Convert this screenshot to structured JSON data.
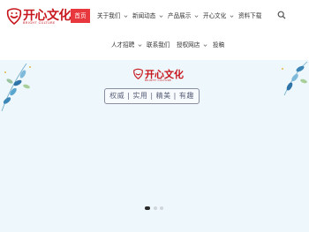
{
  "logo": {
    "name": "开心文化",
    "subtitle": "BRIGHT CULTURE"
  },
  "nav": {
    "row1": [
      {
        "label": "首页",
        "active": true,
        "dropdown": false
      },
      {
        "label": "关于我们",
        "active": false,
        "dropdown": true
      },
      {
        "label": "新闻动态",
        "active": false,
        "dropdown": true
      },
      {
        "label": "产品展示",
        "active": false,
        "dropdown": true
      },
      {
        "label": "开心文化",
        "active": false,
        "dropdown": true
      },
      {
        "label": "资料下载",
        "active": false,
        "dropdown": false
      }
    ],
    "row2": [
      {
        "label": "人才招聘",
        "dropdown": true
      },
      {
        "label": "联系我们",
        "dropdown": false
      },
      {
        "label": "授权网店",
        "dropdown": true
      },
      {
        "label": "投稿",
        "dropdown": false
      }
    ]
  },
  "banner": {
    "logo_name": "开心文化",
    "logo_subtitle": "BRIGHT CULTURE",
    "slogan": "权威 | 实用 | 精美 | 有趣"
  },
  "carousel": {
    "slides": 3,
    "current": 1
  },
  "colors": {
    "accent": "#e8383d",
    "brand": "#c8161e",
    "banner_bg": "#eef7fb"
  }
}
